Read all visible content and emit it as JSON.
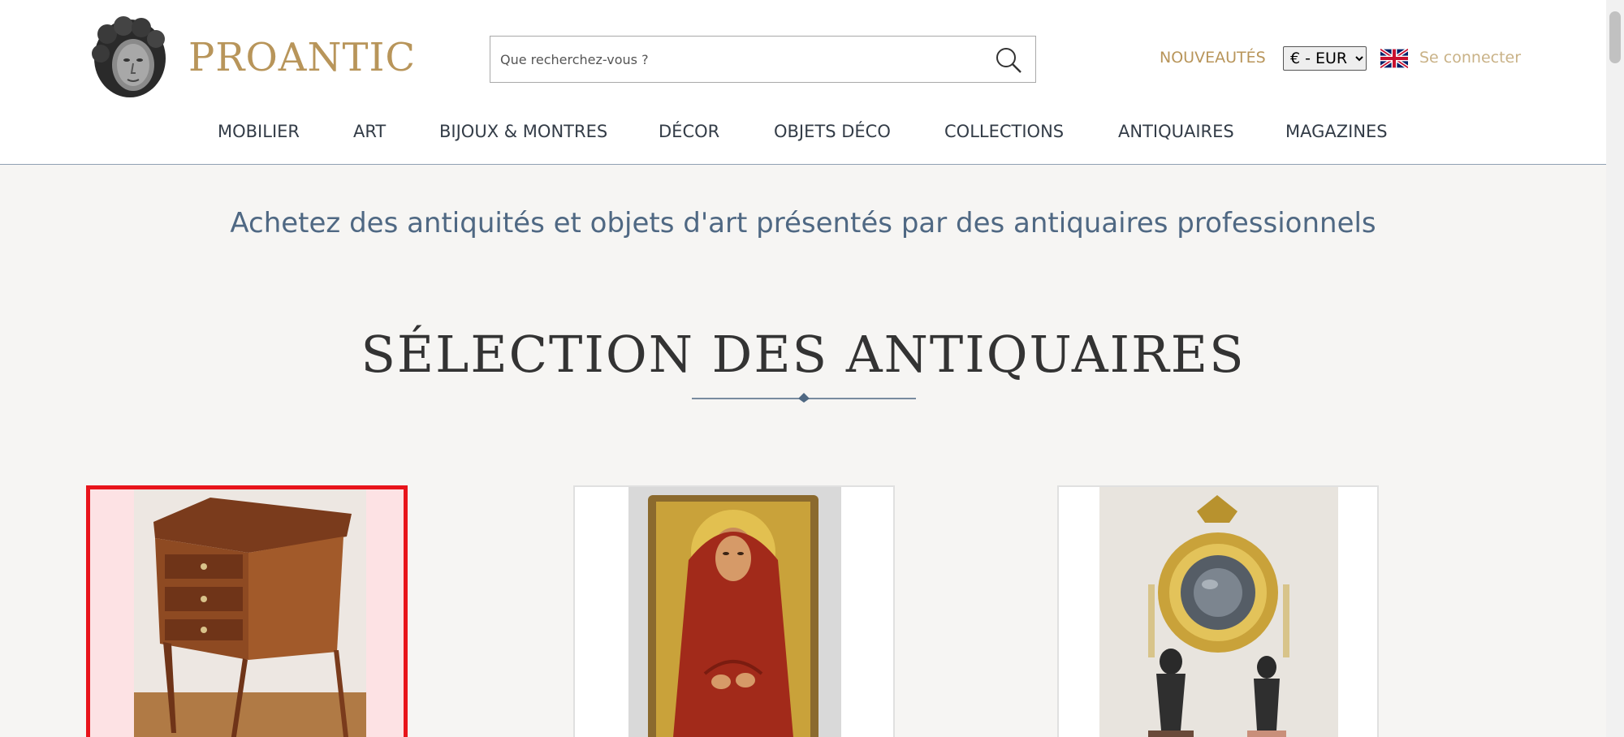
{
  "header": {
    "logo_text": "PROANTIC",
    "search_placeholder": "Que recherchez-vous ?",
    "nouveautes": "NOUVEAUTÉS",
    "currency_selected": "€ - EUR",
    "login": "Se connecter"
  },
  "nav": {
    "items": [
      {
        "label": "MOBILIER"
      },
      {
        "label": "ART"
      },
      {
        "label": "BIJOUX & MONTRES"
      },
      {
        "label": "DÉCOR"
      },
      {
        "label": "OBJETS DÉCO"
      },
      {
        "label": "COLLECTIONS"
      },
      {
        "label": "ANTIQUAIRES"
      },
      {
        "label": "MAGAZINES"
      }
    ]
  },
  "main": {
    "tagline": "Achetez des antiquités et objets d'art présentés par des antiquaires professionnels",
    "section_title": "SÉLECTION DES ANTIQUAIRES"
  },
  "icons": [
    "search-icon",
    "uk-flag-icon",
    "divider-diamond-icon"
  ],
  "colors": {
    "brand_gold": "#b8955a",
    "tagline_blue": "#4f6883",
    "selection_red": "#e8141b",
    "page_bg": "#f6f5f3"
  }
}
